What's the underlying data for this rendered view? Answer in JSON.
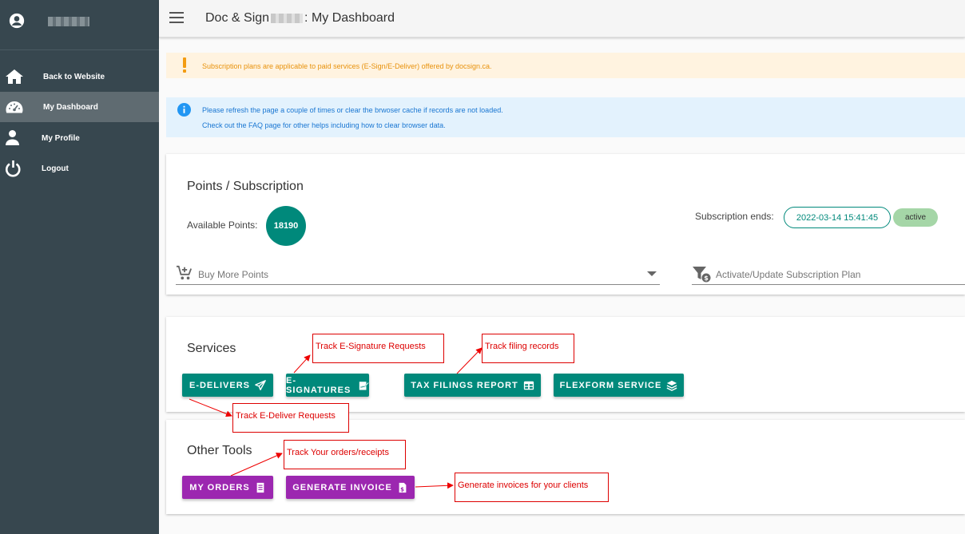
{
  "sidebar": {
    "items": [
      {
        "label": "Back to Website",
        "icon": "home-icon"
      },
      {
        "label": "My Dashboard",
        "icon": "dashboard-icon",
        "active": true
      },
      {
        "label": "My Profile",
        "icon": "person-icon"
      },
      {
        "label": "Logout",
        "icon": "power-icon"
      }
    ]
  },
  "header": {
    "title_prefix": "Doc & Sign",
    "title_suffix": ": My Dashboard"
  },
  "alerts": {
    "warning": "Subscription plans are applicable to paid services (E-Sign/E-Deliver) offered by docsign.ca.",
    "info_line1": "Please refresh the page a couple of times or clear the brwoser cache if records are not loaded.",
    "info_line2": "Check out the FAQ page for other helps including how to clear browser data."
  },
  "points": {
    "title": "Points / Subscription",
    "available_label": "Available Points:",
    "available_value": "18190",
    "subscription_label": "Subscription ends:",
    "subscription_date": "2022-03-14 15:41:45",
    "subscription_status": "active",
    "buy_placeholder": "Buy More Points",
    "plan_placeholder": "Activate/Update Subscription Plan"
  },
  "services": {
    "title": "Services",
    "buttons": [
      "E-DELIVERS",
      "E-SIGNATURES",
      "TAX FILINGS REPORT",
      "FLEXFORM SERVICE"
    ]
  },
  "tools": {
    "title": "Other Tools",
    "buttons": [
      "MY ORDERS",
      "GENERATE INVOICE"
    ]
  },
  "annotations": {
    "esign": "Track E-Signature Requests",
    "tax": "Track filing records",
    "edeliver": "Track E-Deliver Requests",
    "orders": "Track Your orders/receipts",
    "invoice": "Generate invoices for your clients"
  },
  "colors": {
    "sidebar": "#37474f",
    "teal": "#00897b",
    "purple": "#9c27b0",
    "warning": "#e8920c",
    "info": "#1976d2",
    "annotation": "#dd0000"
  }
}
